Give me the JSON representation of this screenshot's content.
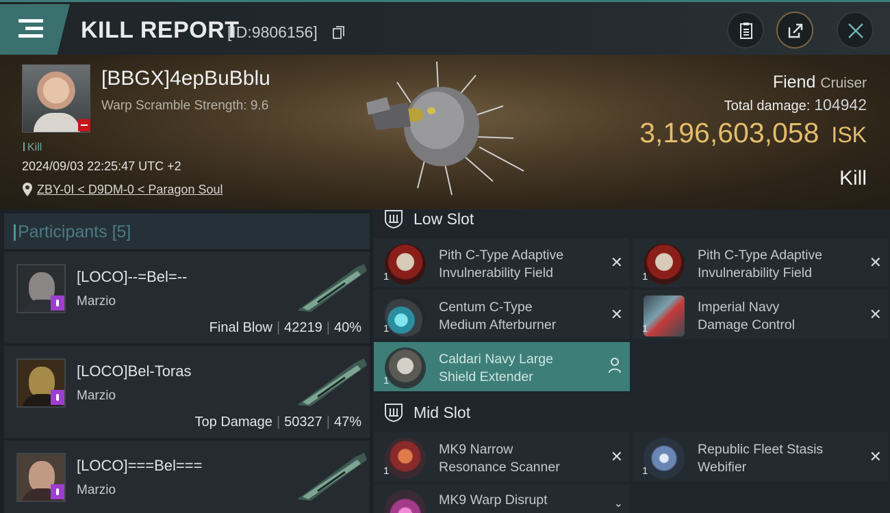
{
  "header": {
    "title": "KILL REPORT",
    "report_id": "[ID:9806156]",
    "icons": [
      "menu-icon",
      "copy-icon",
      "clipboard-icon",
      "share-icon",
      "close-icon"
    ]
  },
  "victim": {
    "name": "[BBGX]4epBuBblu",
    "warp_scramble": "Warp Scramble Strength: 9.6",
    "tag": "Kill",
    "datetime": "2024/09/03 22:25:47 UTC +2",
    "location": "ZBY-0I < D9DM-0 < Paragon Soul",
    "ship_name": "Fiend",
    "ship_class": "Cruiser",
    "total_damage_label": "Total damage:",
    "total_damage": "104942",
    "isk_value": "3,196,603,058",
    "isk_unit": "ISK",
    "result": "Kill"
  },
  "participants": {
    "label": "Participants",
    "count": "[5]",
    "rows": [
      {
        "name": "[LOCO]--=Bel=--",
        "sub": "Marzio",
        "role": "Final Blow",
        "damage": "42219",
        "pct": "40%"
      },
      {
        "name": "[LOCO]Bel-Toras",
        "sub": "Marzio",
        "role": "Top Damage",
        "damage": "50327",
        "pct": "47%"
      },
      {
        "name": "[LOCO]===Bel===",
        "sub": "Marzio",
        "role": "",
        "damage": "",
        "pct": ""
      }
    ]
  },
  "fitting": {
    "low_slot_label": "Low Slot",
    "mid_slot_label": "Mid Slot",
    "low": [
      {
        "line1": "Pith C-Type Adaptive",
        "line2": "Invulnerability Field",
        "qty": "1"
      },
      {
        "line1": "Pith C-Type Adaptive",
        "line2": "Invulnerability Field",
        "qty": "1"
      },
      {
        "line1": "Centum C-Type",
        "line2": "Medium Afterburner",
        "qty": "1"
      },
      {
        "line1": "Imperial Navy",
        "line2": "Damage Control",
        "qty": "1"
      },
      {
        "line1": "Caldari Navy Large",
        "line2": "Shield Extender",
        "qty": "1"
      }
    ],
    "mid": [
      {
        "line1": "MK9 Narrow",
        "line2": "Resonance Scanner",
        "qty": "1"
      },
      {
        "line1": "Republic Fleet Stasis",
        "line2": "Webifier",
        "qty": "1"
      },
      {
        "line1": "MK9 Warp Disrupt",
        "line2": "",
        "qty": ""
      }
    ],
    "destroyed_mark": "✕"
  },
  "colors": {
    "accent": "#3d7e79",
    "isk_gold": "#e4bd6c",
    "badge_red": "#c8141b",
    "badge_purple": "#9d3ed0"
  }
}
